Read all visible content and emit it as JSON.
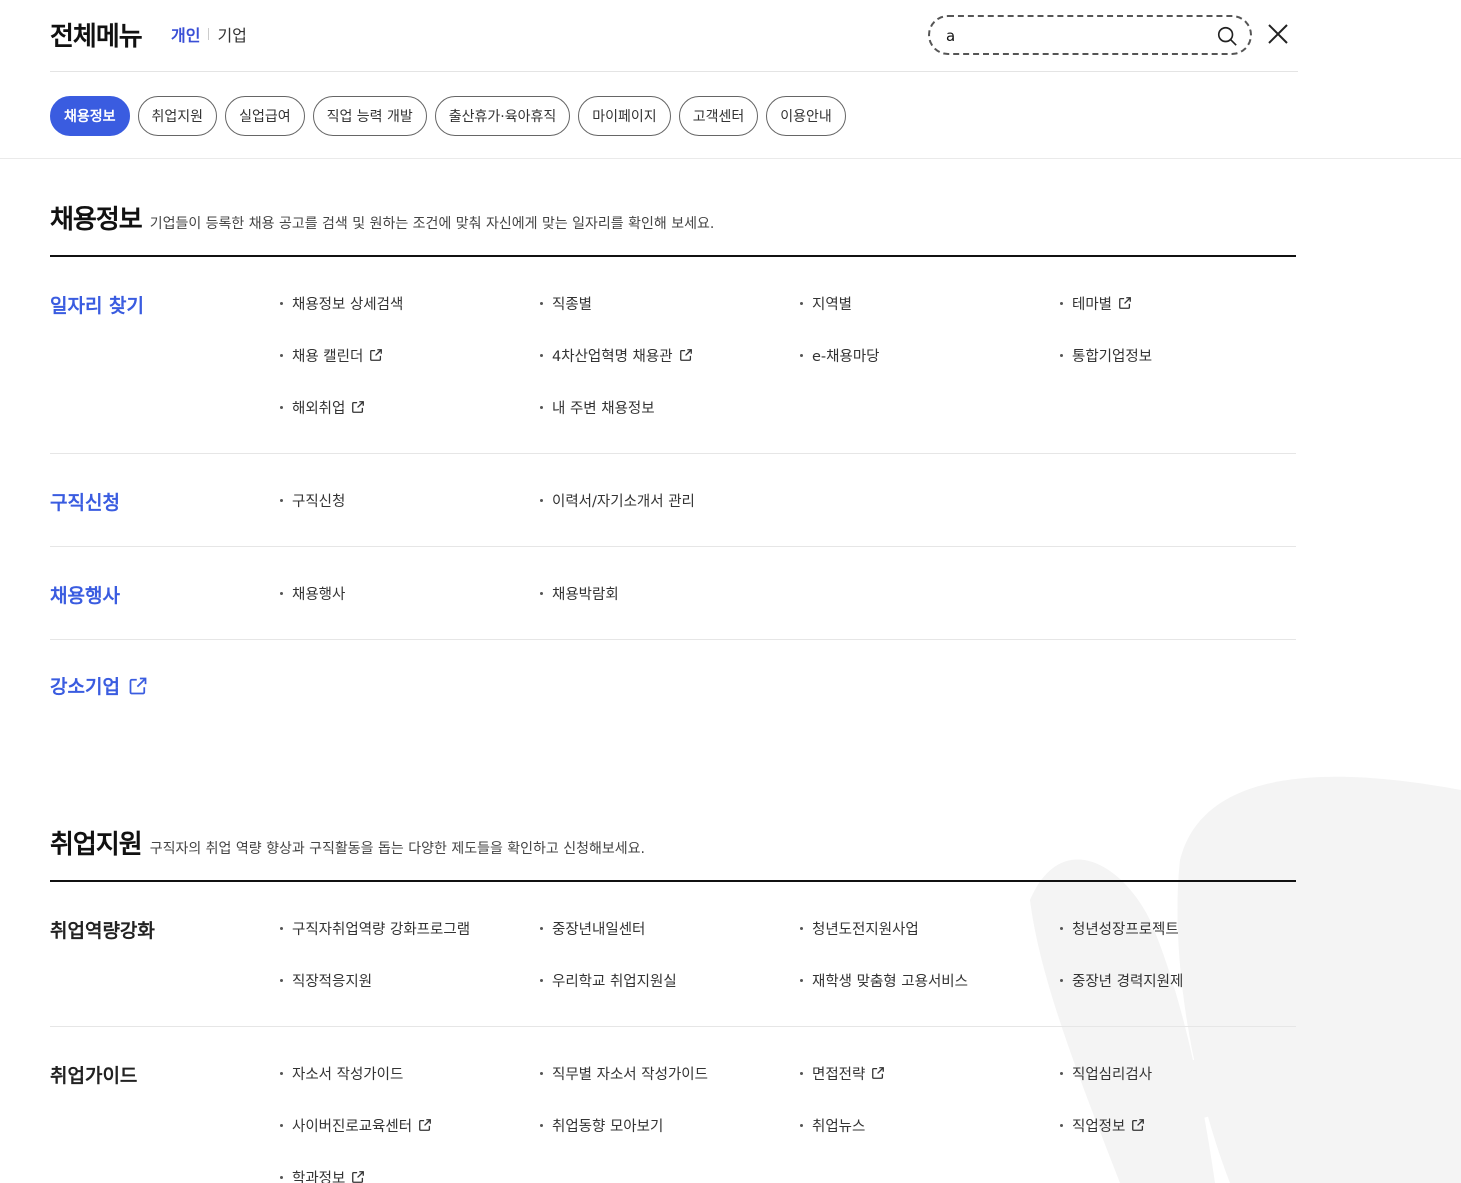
{
  "header": {
    "title": "전체메뉴",
    "user_tabs": [
      "개인",
      "기업"
    ],
    "search": {
      "value": "a",
      "placeholder": ""
    }
  },
  "category_tabs": [
    "채용정보",
    "취업지원",
    "실업급여",
    "직업 능력 개발",
    "출산휴가·육아휴직",
    "마이페이지",
    "고객센터",
    "이용안내"
  ],
  "sections": [
    {
      "title": "채용정보",
      "desc": "기업들이 등록한 채용 공고를 검색 및 원하는 조건에 맞춰 자신에게 맞는 일자리를 확인해 보세요.",
      "groups": [
        {
          "title": "일자리 찾기",
          "items": [
            "채용정보 상세검색",
            "직종별",
            "지역별",
            "테마별",
            "채용 캘린더",
            "4차산업혁명 채용관",
            "e-채용마당",
            "통합기업정보",
            "해외취업",
            "내 주변 채용정보"
          ]
        },
        {
          "title": "구직신청",
          "items": [
            "구직신청",
            "이력서/자기소개서 관리"
          ]
        },
        {
          "title": "채용행사",
          "items": [
            "채용행사",
            "채용박람회"
          ]
        },
        {
          "title": "강소기업",
          "items": []
        }
      ]
    },
    {
      "title": "취업지원",
      "desc": "구직자의 취업 역량 향상과 구직활동을 돕는 다양한 제도들을 확인하고 신청해보세요.",
      "groups": [
        {
          "title": "취업역량강화",
          "items": [
            "구직자취업역량 강화프로그램",
            "중장년내일센터",
            "청년도전지원사업",
            "청년성장프로젝트",
            "직장적응지원",
            "우리학교 취업지원실",
            "재학생 맞춤형 고용서비스",
            "중장년 경력지원제"
          ]
        },
        {
          "title": "취업가이드",
          "items": [
            "자소서 작성가이드",
            "직무별 자소서 작성가이드",
            "면접전략",
            "직업심리검사",
            "사이버진로교육센터",
            "취업동향 모아보기",
            "취업뉴스",
            "직업정보",
            "학과정보"
          ]
        }
      ]
    }
  ],
  "colors": {
    "accent": "#3a5ce0",
    "text": "#222222",
    "divider": "#e6e6e6"
  },
  "icons": [
    "search-icon",
    "close-icon",
    "external-link-icon"
  ]
}
